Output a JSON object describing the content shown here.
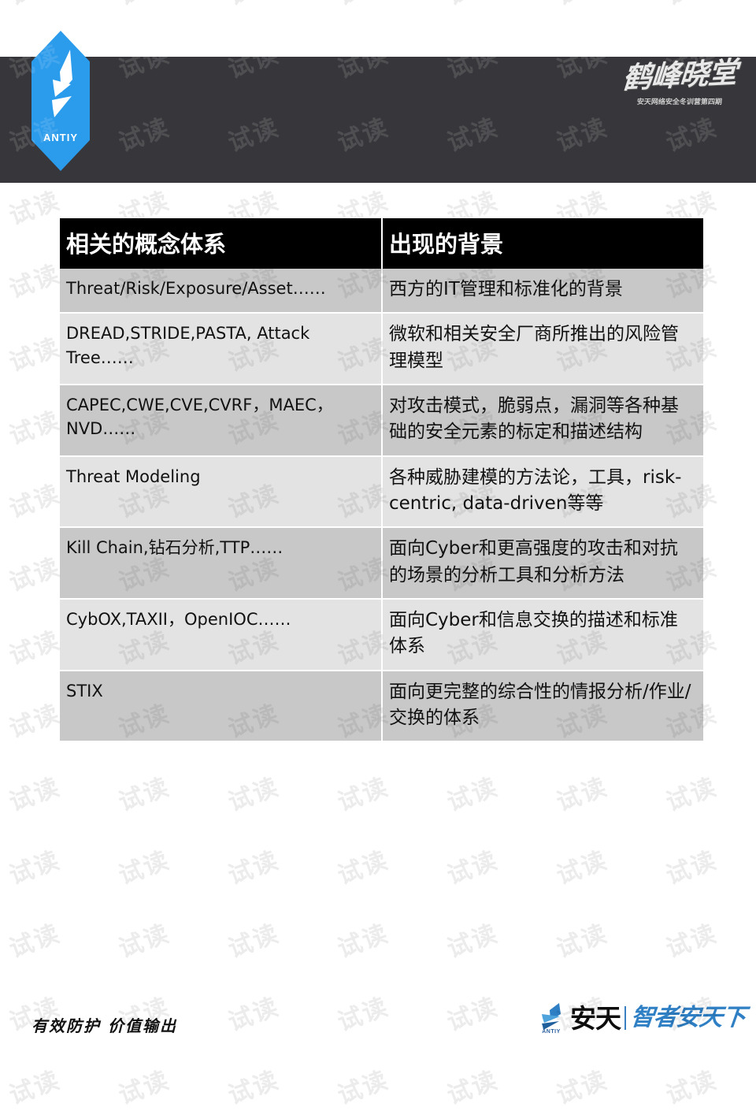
{
  "header": {
    "logo_name": "antiy-hexagon-logo",
    "logo_wordmark": "ANTIY",
    "logo_color": "#2b9bec",
    "band_color": "#37373b",
    "calligraphy_title": "鹤峰晓堂",
    "calligraphy_subtitle": "安天网络安全冬训营第四期"
  },
  "table": {
    "columns": [
      {
        "label": "相关的概念体系"
      },
      {
        "label": "出现的背景"
      }
    ],
    "header_bg": "#000000",
    "header_fg": "#ffffff",
    "band_a_color": "#c8c8c8",
    "band_b_color": "#e3e3e3",
    "rows": [
      {
        "term": "Threat/Risk/Exposure/Asset……",
        "context": "西方的IT管理和标准化的背景"
      },
      {
        "term": "DREAD,STRIDE,PASTA, Attack Tree……",
        "context": "微软和相关安全厂商所推出的风险管理模型"
      },
      {
        "term": "CAPEC,CWE,CVE,CVRF，MAEC，NVD……",
        "context": "对攻击模式，脆弱点，漏洞等各种基础的安全元素的标定和描述结构"
      },
      {
        "term": "Threat Modeling",
        "context": "各种威胁建模的方法论，工具，risk-centric, data-driven等等"
      },
      {
        "term": "Kill Chain,钻石分析,TTP……",
        "context": "面向Cyber和更高强度的攻击和对抗的场景的分析工具和分析方法"
      },
      {
        "term": "CybOX,TAXII，OpenIOC……",
        "context": "面向Cyber和信息交换的描述和标准体系"
      },
      {
        "term": "STIX",
        "context": "面向更完整的综合性的情报分析/作业/交换的体系"
      }
    ]
  },
  "footer": {
    "slogan": "有效防护 价值输出",
    "brand": "安天",
    "brand_mark": "ANTIY",
    "tagline": "智者安天下",
    "accent_color": "#2f7fc4"
  },
  "watermark": {
    "text": "试读"
  }
}
